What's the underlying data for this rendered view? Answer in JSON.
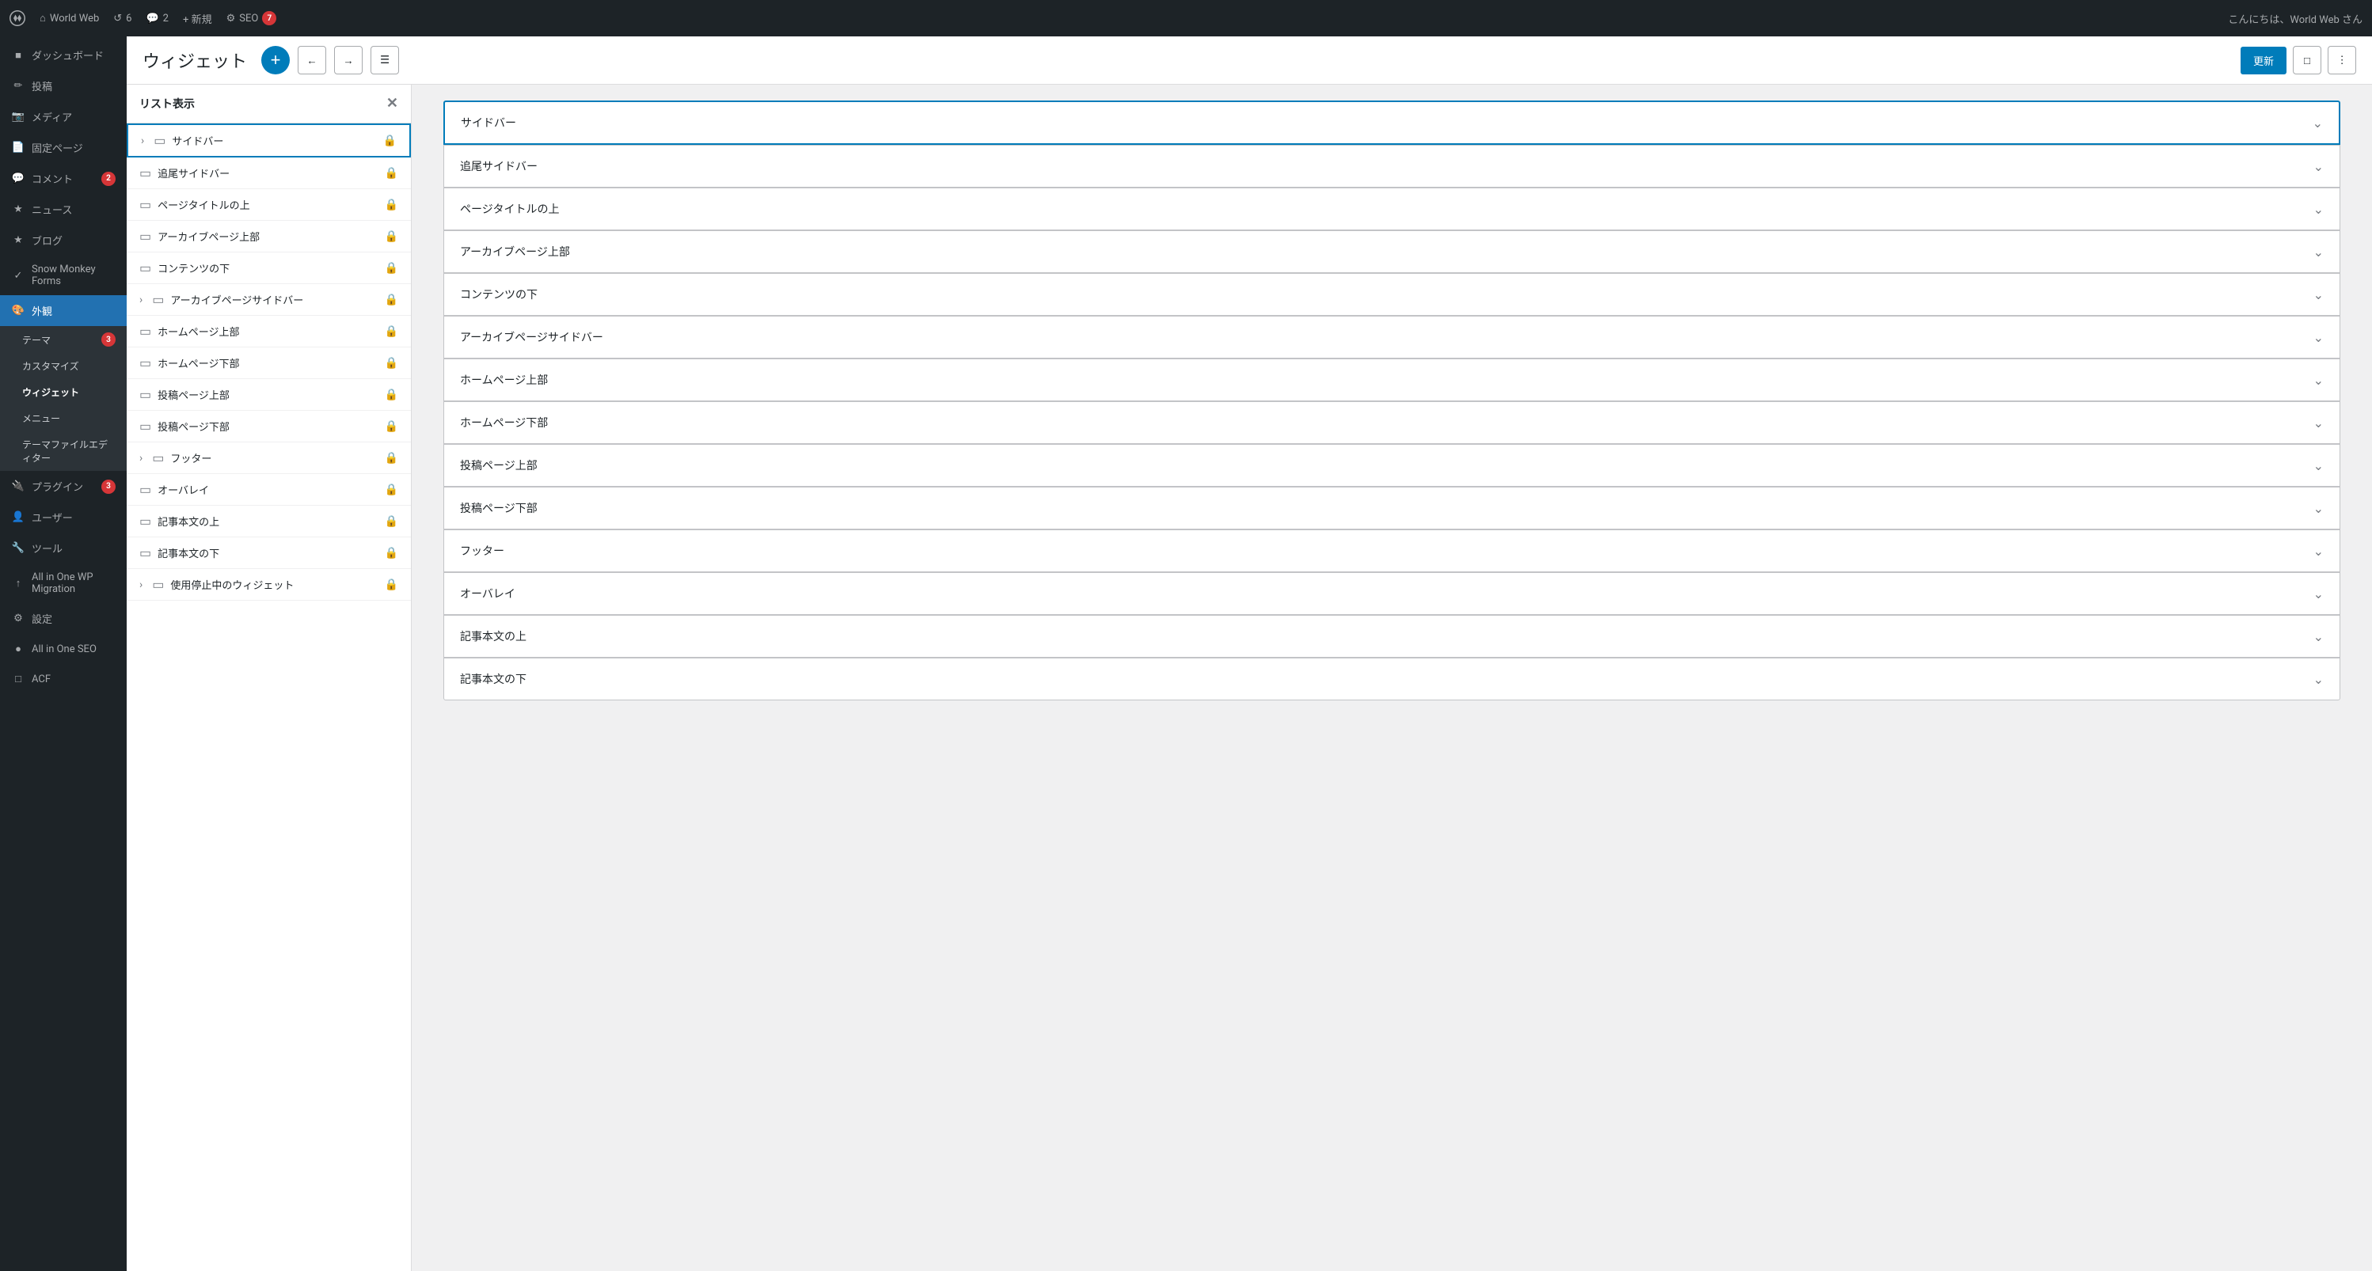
{
  "adminbar": {
    "site_name": "World Web",
    "new_label": "+ 新規",
    "comments_count": "6",
    "messages_count": "2",
    "seo_label": "SEO",
    "seo_count": "7",
    "greeting": "こんにちは、World Web さん"
  },
  "sidebar": {
    "items": [
      {
        "id": "dashboard",
        "label": "ダッシュボード",
        "icon": "dashboard",
        "badge": null,
        "active": false
      },
      {
        "id": "posts",
        "label": "投稿",
        "icon": "posts",
        "badge": null,
        "active": false
      },
      {
        "id": "media",
        "label": "メディア",
        "icon": "media",
        "badge": null,
        "active": false
      },
      {
        "id": "pages",
        "label": "固定ページ",
        "icon": "pages",
        "badge": null,
        "active": false
      },
      {
        "id": "comments",
        "label": "コメント",
        "icon": "comments",
        "badge": "2",
        "active": false
      },
      {
        "id": "news",
        "label": "ニュース",
        "icon": "news",
        "badge": null,
        "active": false
      },
      {
        "id": "blog",
        "label": "ブログ",
        "icon": "blog",
        "badge": null,
        "active": false
      },
      {
        "id": "snow-monkey-forms",
        "label": "Snow Monkey Forms",
        "icon": "forms",
        "badge": null,
        "active": false
      },
      {
        "id": "appearance",
        "label": "外観",
        "icon": "appearance",
        "badge": null,
        "active": true
      },
      {
        "id": "plugins",
        "label": "プラグイン",
        "icon": "plugins",
        "badge": "3",
        "active": false
      },
      {
        "id": "users",
        "label": "ユーザー",
        "icon": "users",
        "badge": null,
        "active": false
      },
      {
        "id": "tools",
        "label": "ツール",
        "icon": "tools",
        "badge": null,
        "active": false
      },
      {
        "id": "migration",
        "label": "All in One WP Migration",
        "icon": "migration",
        "badge": null,
        "active": false
      },
      {
        "id": "settings",
        "label": "設定",
        "icon": "settings",
        "badge": null,
        "active": false
      },
      {
        "id": "aio-seo",
        "label": "All in One SEO",
        "icon": "seo",
        "badge": null,
        "active": false
      },
      {
        "id": "ace",
        "label": "ACF",
        "icon": "acf",
        "badge": null,
        "active": false
      }
    ],
    "submenu": {
      "parent": "appearance",
      "items": [
        {
          "id": "themes",
          "label": "テーマ",
          "badge": "3",
          "active": false
        },
        {
          "id": "customize",
          "label": "カスタマイズ",
          "badge": null,
          "active": false
        },
        {
          "id": "widgets",
          "label": "ウィジェット",
          "badge": null,
          "active": true
        },
        {
          "id": "menus",
          "label": "メニュー",
          "badge": null,
          "active": false
        },
        {
          "id": "theme-file-editor",
          "label": "テーマファイルエディター",
          "badge": null,
          "active": false
        }
      ]
    }
  },
  "widget_editor": {
    "title": "ウィジェット",
    "add_button_label": "+",
    "update_button": "更新",
    "panel_title": "リスト表示",
    "list_items": [
      {
        "id": "sidebar",
        "label": "サイドバー",
        "has_chevron": true,
        "selected": true,
        "lock": true
      },
      {
        "id": "tracking-sidebar",
        "label": "追尾サイドバー",
        "has_chevron": false,
        "selected": false,
        "lock": true
      },
      {
        "id": "page-title-top",
        "label": "ページタイトルの上",
        "has_chevron": false,
        "selected": false,
        "lock": true
      },
      {
        "id": "archive-top",
        "label": "アーカイブページ上部",
        "has_chevron": false,
        "selected": false,
        "lock": true
      },
      {
        "id": "content-below",
        "label": "コンテンツの下",
        "has_chevron": false,
        "selected": false,
        "lock": true
      },
      {
        "id": "archive-sidebar",
        "label": "アーカイブページサイドバー",
        "has_chevron": true,
        "selected": false,
        "lock": true
      },
      {
        "id": "homepage-top",
        "label": "ホームページ上部",
        "has_chevron": false,
        "selected": false,
        "lock": true
      },
      {
        "id": "homepage-bottom",
        "label": "ホームページ下部",
        "has_chevron": false,
        "selected": false,
        "lock": true
      },
      {
        "id": "post-top",
        "label": "投稿ページ上部",
        "has_chevron": false,
        "selected": false,
        "lock": true
      },
      {
        "id": "post-bottom",
        "label": "投稿ページ下部",
        "has_chevron": false,
        "selected": false,
        "lock": true
      },
      {
        "id": "footer",
        "label": "フッター",
        "has_chevron": true,
        "selected": false,
        "lock": true
      },
      {
        "id": "overlay",
        "label": "オーバレイ",
        "has_chevron": false,
        "selected": false,
        "lock": true
      },
      {
        "id": "article-top",
        "label": "記事本文の上",
        "has_chevron": false,
        "selected": false,
        "lock": true
      },
      {
        "id": "article-bottom",
        "label": "記事本文の下",
        "has_chevron": false,
        "selected": false,
        "lock": true
      },
      {
        "id": "disabled-widgets",
        "label": "使用停止中のウィジェット",
        "has_chevron": true,
        "selected": false,
        "lock": true
      }
    ],
    "accordion_items": [
      {
        "id": "sidebar",
        "label": "サイドバー",
        "selected": true
      },
      {
        "id": "tracking-sidebar",
        "label": "追尾サイドバー",
        "selected": false
      },
      {
        "id": "page-title-top",
        "label": "ページタイトルの上",
        "selected": false
      },
      {
        "id": "archive-top",
        "label": "アーカイブページ上部",
        "selected": false
      },
      {
        "id": "content-below",
        "label": "コンテンツの下",
        "selected": false
      },
      {
        "id": "archive-sidebar",
        "label": "アーカイブページサイドバー",
        "selected": false
      },
      {
        "id": "homepage-top",
        "label": "ホームページ上部",
        "selected": false
      },
      {
        "id": "homepage-bottom",
        "label": "ホームページ下部",
        "selected": false
      },
      {
        "id": "post-top",
        "label": "投稿ページ上部",
        "selected": false
      },
      {
        "id": "post-bottom",
        "label": "投稿ページ下部",
        "selected": false
      },
      {
        "id": "footer",
        "label": "フッター",
        "selected": false
      },
      {
        "id": "overlay",
        "label": "オーバレイ",
        "selected": false
      },
      {
        "id": "article-top",
        "label": "記事本文の上",
        "selected": false
      },
      {
        "id": "article-bottom",
        "label": "記事本文の下",
        "selected": false
      }
    ]
  }
}
